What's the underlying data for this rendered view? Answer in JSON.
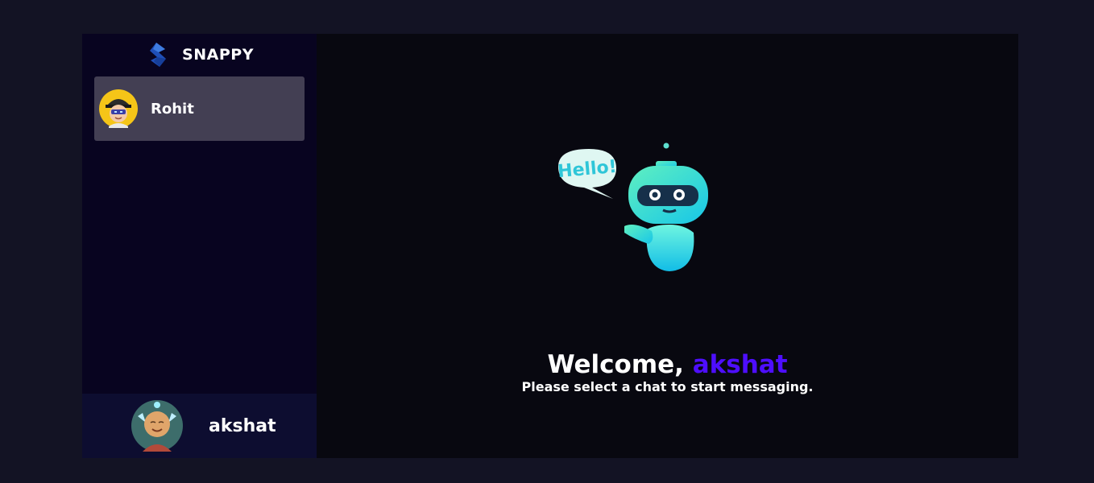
{
  "brand": {
    "name": "SNAPPY",
    "logo_icon": "snappy-logo-icon"
  },
  "contacts": [
    {
      "name": "Rohit",
      "avatar_icon": "rohit-avatar-icon",
      "selected": true
    }
  ],
  "current_user": {
    "name": "akshat",
    "avatar_icon": "akshat-avatar-icon"
  },
  "welcome": {
    "greeting": "Welcome, ",
    "username": "akshat",
    "subtitle": "Please select a chat to start messaging.",
    "robot_speech": "Hello!",
    "illustration_icon": "robot-hello-icon"
  },
  "colors": {
    "page_bg": "#131324",
    "sidebar_bg": "#080420",
    "selected_contact_bg": "#433f53",
    "user_bar_bg": "#0d0d30",
    "accent": "#4e0eff"
  }
}
